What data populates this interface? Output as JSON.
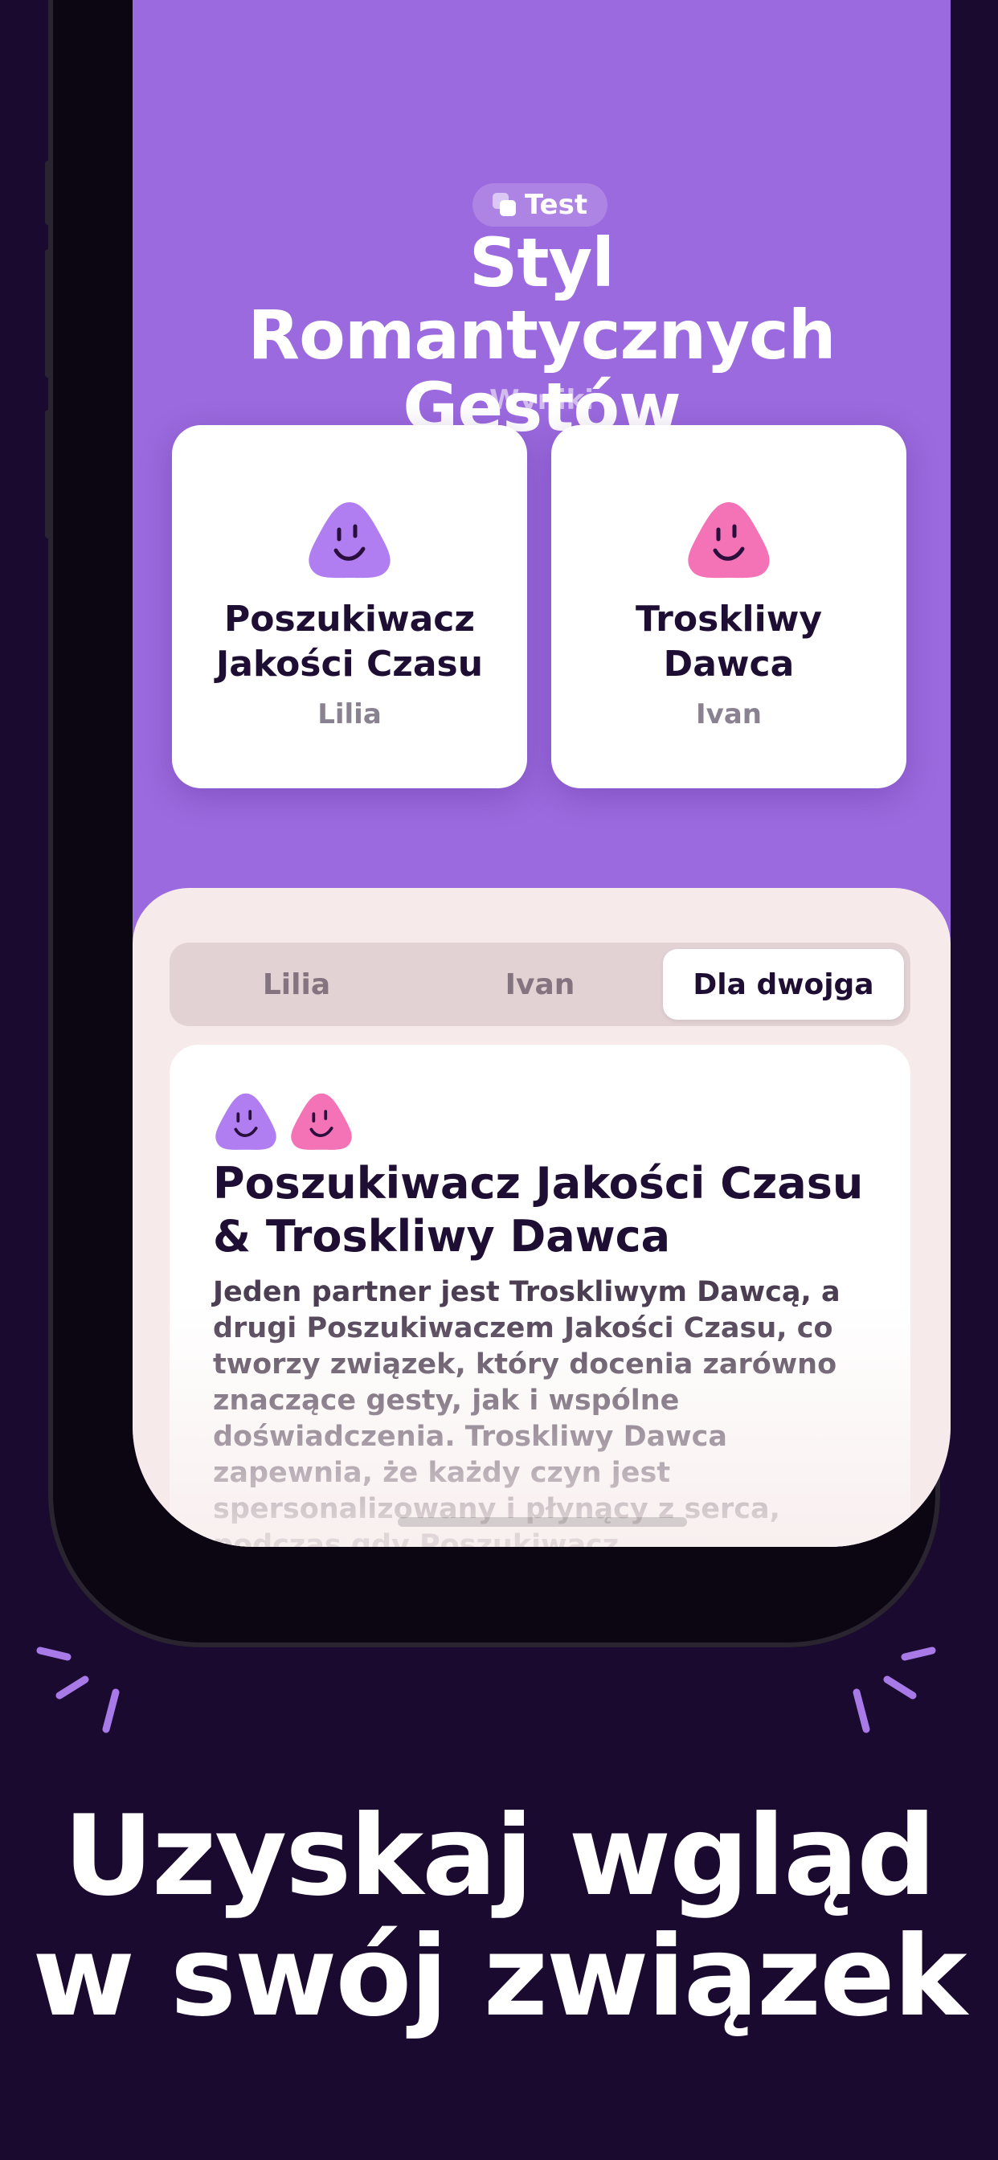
{
  "colors": {
    "background": "#1b0a30",
    "screen_purple": "#9b6ade",
    "sheet_bg": "#f6eaea",
    "avatar_purple": "#b07ef0",
    "avatar_pink": "#f472b6",
    "spark": "#a87ae8"
  },
  "header": {
    "pill_label": "Test",
    "pill_icon": "layers-icon",
    "title": "Styl Romantycznych Gestów",
    "subtitle": "Wyniki"
  },
  "cards": [
    {
      "type": "Poszukiwacz Jakości Czasu",
      "person": "Lilia",
      "avatar_icon": "smiley-blob-purple-icon"
    },
    {
      "type": "Troskliwy Dawca",
      "person": "Ivan",
      "avatar_icon": "smiley-blob-pink-icon"
    }
  ],
  "tabs": [
    {
      "label": "Lilia",
      "active": false
    },
    {
      "label": "Ivan",
      "active": false
    },
    {
      "label": "Dla dwojga",
      "active": true
    }
  ],
  "result": {
    "title": "Poszukiwacz Jakości Czasu & Troskliwy Dawca",
    "body": "Jeden partner jest Troskliwym Dawcą, a drugi Poszukiwaczem Jakości Czasu, co tworzy związek, który docenia zarówno znaczące gesty, jak i wspólne doświadczenia. Troskliwy Dawca zapewnia, że każdy czyn jest spersonalizowany i płynący z serca, podczas gdy Poszukiwacz"
  },
  "promo": {
    "headline": "Uzyskaj wgląd w swój związek"
  }
}
